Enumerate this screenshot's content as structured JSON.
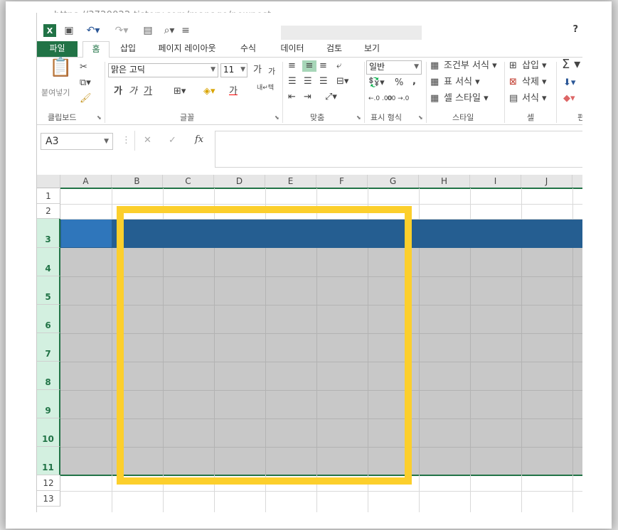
{
  "url": "https://3720022.tistory.com/manage/newpost",
  "help_label": "?",
  "tabs": [
    "파일",
    "홈",
    "삽입",
    "페이지 레이아웃",
    "수식",
    "데이터",
    "검토",
    "보기"
  ],
  "clipboard": {
    "paste_label": "붙여넣기",
    "group_label": "클립보드"
  },
  "font": {
    "name": "맑은 고딕",
    "size": "11",
    "grow": "가",
    "shrink": "가",
    "bold": "가",
    "italic": "가",
    "underline": "가",
    "color_glyph": "가",
    "group_label": "글꼴"
  },
  "alignment": {
    "wrap_label": "내↵텍",
    "group_label": "맞춤"
  },
  "number": {
    "format": "일반",
    "percent": "%",
    "comma": ",",
    "inc_decimal": "←.0 .00",
    "dec_decimal": ".00 →.0",
    "group_label": "표시 형식"
  },
  "styles": {
    "conditional": "조건부 서식",
    "table": "표 서식",
    "cell": "셀 스타일",
    "group_label": "스타일"
  },
  "cells": {
    "insert": "삽입",
    "delete": "삭제",
    "format": "서식",
    "group_label": "셀"
  },
  "editing": {
    "group_label": "편"
  },
  "formula_bar": {
    "namebox": "A3",
    "cancel": "✕",
    "enter": "✓",
    "fx": "fx",
    "value": ""
  },
  "columns": [
    "A",
    "B",
    "C",
    "D",
    "E",
    "F",
    "G",
    "H",
    "I",
    "J"
  ],
  "rows": [
    "1",
    "2",
    "3",
    "4",
    "5",
    "6",
    "7",
    "8",
    "9",
    "10",
    "11",
    "12",
    "13"
  ],
  "colors": {
    "excel_green": "#217346",
    "header_blue": "#255e91",
    "selected_blue": "#2f76bb",
    "body_gray": "#c8c8c8",
    "highlight_yellow": "#fccf2c"
  }
}
